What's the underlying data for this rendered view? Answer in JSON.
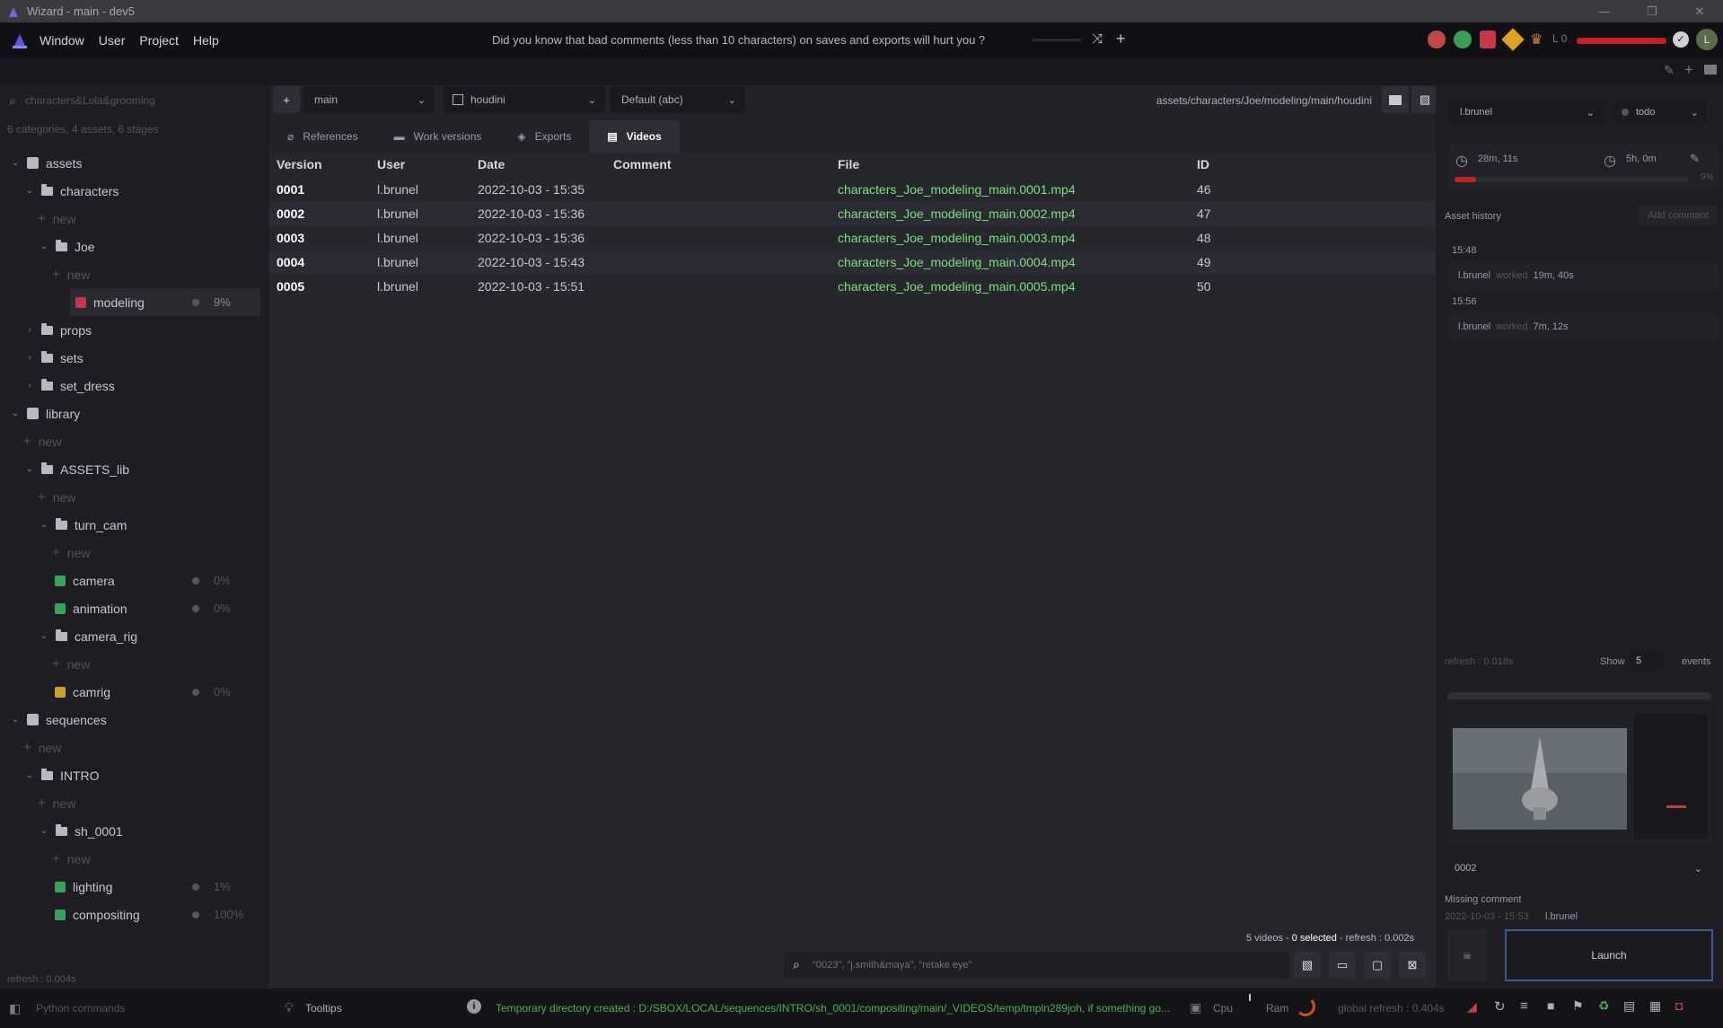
{
  "window": {
    "title": "Wizard - main - dev5"
  },
  "menu": {
    "items": [
      "Window",
      "User",
      "Project",
      "Help"
    ]
  },
  "tip": "Did you know that bad comments (less than 10 characters) on saves and exports will hurt you ?",
  "header": {
    "level_label": "L 0",
    "avatar_letter": "L"
  },
  "sidebar": {
    "search_value": "characters&Lola&grooming",
    "summary": "6 categories, 4 assets, 6 stages",
    "refresh": "refresh : 0.004s",
    "tree": [
      {
        "label": "assets",
        "kind": "domain",
        "depth": 0,
        "expanded": true
      },
      {
        "label": "characters",
        "kind": "folder",
        "depth": 1,
        "expanded": true
      },
      {
        "label": "new",
        "kind": "new",
        "depth": 2
      },
      {
        "label": "Joe",
        "kind": "folder",
        "depth": 2,
        "expanded": true
      },
      {
        "label": "new",
        "kind": "new",
        "depth": 3
      },
      {
        "label": "modeling",
        "kind": "stage",
        "depth": 3,
        "percent": "9%",
        "icon_color": "#c0394b",
        "selected": true
      },
      {
        "label": "props",
        "kind": "folder",
        "depth": 1,
        "expanded": false
      },
      {
        "label": "sets",
        "kind": "folder",
        "depth": 1,
        "expanded": false
      },
      {
        "label": "set_dress",
        "kind": "folder",
        "depth": 1,
        "expanded": false
      },
      {
        "label": "library",
        "kind": "domain",
        "depth": 0,
        "expanded": true
      },
      {
        "label": "new",
        "kind": "new",
        "depth": 1
      },
      {
        "label": "ASSETS_lib",
        "kind": "folder",
        "depth": 1,
        "expanded": true
      },
      {
        "label": "new",
        "kind": "new",
        "depth": 2
      },
      {
        "label": "turn_cam",
        "kind": "folder",
        "depth": 2,
        "expanded": true
      },
      {
        "label": "new",
        "kind": "new",
        "depth": 3
      },
      {
        "label": "camera",
        "kind": "stage",
        "depth": 3,
        "percent": "0%",
        "icon_color": "#3aa35a"
      },
      {
        "label": "animation",
        "kind": "stage",
        "depth": 3,
        "percent": "0%",
        "icon_color": "#3aa35a"
      },
      {
        "label": "camera_rig",
        "kind": "folder",
        "depth": 2,
        "expanded": true
      },
      {
        "label": "new",
        "kind": "new",
        "depth": 3
      },
      {
        "label": "camrig",
        "kind": "stage",
        "depth": 3,
        "percent": "0%",
        "icon_color": "#c9a227"
      },
      {
        "label": "sequences",
        "kind": "domain",
        "depth": 0,
        "expanded": true
      },
      {
        "label": "new",
        "kind": "new",
        "depth": 1
      },
      {
        "label": "INTRO",
        "kind": "folder",
        "depth": 1,
        "expanded": true
      },
      {
        "label": "new",
        "kind": "new",
        "depth": 2
      },
      {
        "label": "sh_0001",
        "kind": "folder",
        "depth": 2,
        "expanded": true
      },
      {
        "label": "new",
        "kind": "new",
        "depth": 3
      },
      {
        "label": "lighting",
        "kind": "stage",
        "depth": 3,
        "percent": "1%",
        "icon_color": "#3aa35a"
      },
      {
        "label": "compositing",
        "kind": "stage",
        "depth": 3,
        "percent": "100%",
        "icon_color": "#3aa35a"
      }
    ]
  },
  "toolbar": {
    "variant": "main",
    "software": "houdini",
    "export_set": "Default (abc)",
    "path": "assets/characters/Joe/modeling/main/houdini"
  },
  "tabs": [
    {
      "label": "References",
      "icon": "paperclip-icon"
    },
    {
      "label": "Work versions",
      "icon": "folder-icon"
    },
    {
      "label": "Exports",
      "icon": "cube-icon"
    },
    {
      "label": "Videos",
      "icon": "clapperboard-icon",
      "active": true
    }
  ],
  "table": {
    "columns": [
      "Version",
      "User",
      "Date",
      "Comment",
      "File",
      "ID"
    ],
    "rows": [
      {
        "version": "0001",
        "user": "l.brunel",
        "date": "2022-10-03 - 15:35",
        "comment": "",
        "file": "characters_Joe_modeling_main.0001.mp4",
        "id": "46"
      },
      {
        "version": "0002",
        "user": "l.brunel",
        "date": "2022-10-03 - 15:36",
        "comment": "",
        "file": "characters_Joe_modeling_main.0002.mp4",
        "id": "47"
      },
      {
        "version": "0003",
        "user": "l.brunel",
        "date": "2022-10-03 - 15:36",
        "comment": "",
        "file": "characters_Joe_modeling_main.0003.mp4",
        "id": "48"
      },
      {
        "version": "0004",
        "user": "l.brunel",
        "date": "2022-10-03 - 15:43",
        "comment": "",
        "file": "characters_Joe_modeling_main.0004.mp4",
        "id": "49"
      },
      {
        "version": "0005",
        "user": "l.brunel",
        "date": "2022-10-03 - 15:51",
        "comment": "",
        "file": "characters_Joe_modeling_main.0005.mp4",
        "id": "50"
      }
    ]
  },
  "footer": {
    "count_text": "5 videos - ",
    "selected_text": "0 selected",
    "refresh_text": " - refresh : 0.002s",
    "search_placeholder": "\"0023\", \"j.smith&maya\", \"retake eye\""
  },
  "right_panel": {
    "user": "l.brunel",
    "state": "todo",
    "time_spent": "28m, 11s",
    "estimated": "5h, 0m",
    "progress_label": "9%",
    "progress": 0.09,
    "history_title": "Asset history",
    "add_comment": "Add comment",
    "events": [
      {
        "time": "15:48",
        "user": "l.brunel",
        "action": "worked",
        "duration": "19m, 40s"
      },
      {
        "time": "15:56",
        "user": "l.brunel",
        "action": "worked",
        "duration": "7m, 12s"
      }
    ],
    "refresh": "refresh : 0.018s",
    "show_label": "Show",
    "show_count": "5",
    "events_label": "events",
    "version_select": "0002",
    "version_comment": "Missing comment",
    "version_date": "2022-10-03 - 15:53",
    "version_user": "l.brunel",
    "launch": "Launch"
  },
  "statusbar": {
    "python": "Python commands",
    "tooltips": "Tooltips",
    "message": "Temporary directory created : D:/SBOX/LOCAL/sequences/INTRO/sh_0001/compositing/main/_VIDEOS/temp/tmpln289joh, if something go...",
    "cpu": "Cpu",
    "ram": "Ram",
    "global_refresh": "global refresh : 0.404s"
  },
  "colors": {
    "accent_green": "#7fe07f",
    "stage_red": "#c0394b",
    "progress_red": "#c8201e",
    "message_green": "#4fb04f"
  }
}
